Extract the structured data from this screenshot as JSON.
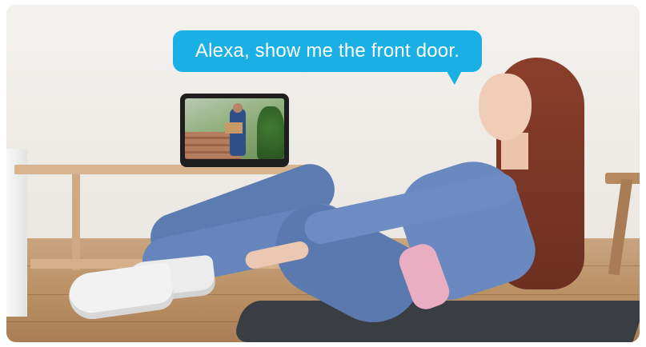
{
  "speech_bubble": {
    "text": "Alexa, show me the front door.",
    "color": "#1ab0e6"
  },
  "scene": {
    "device_screen_icon": "doorbell-camera-feed"
  }
}
